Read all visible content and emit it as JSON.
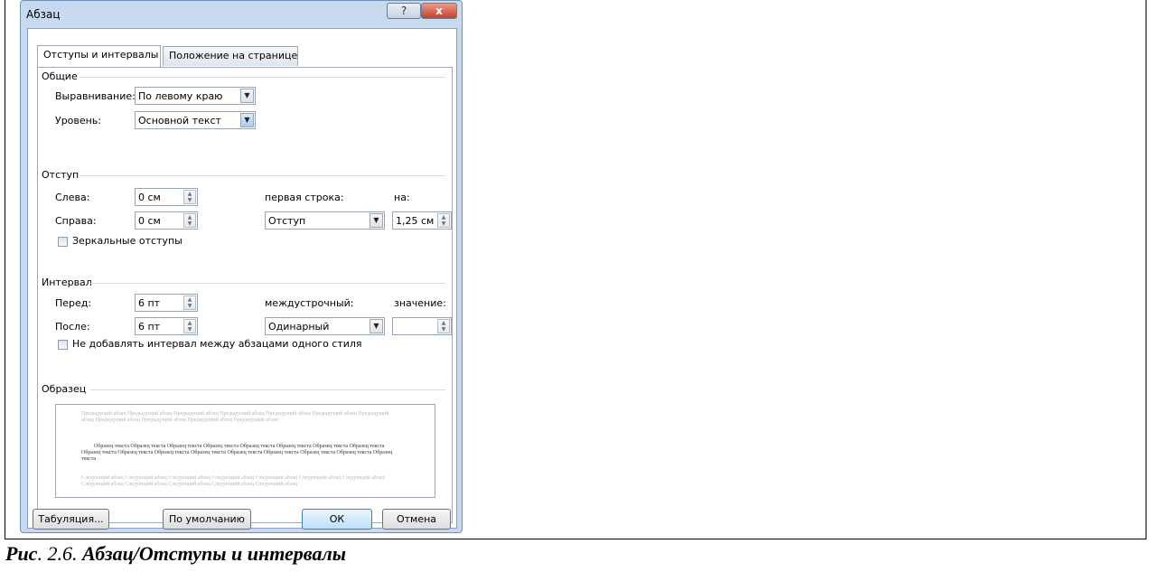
{
  "dialog": {
    "title": "Абзац",
    "help_label": "?",
    "close_label": "x"
  },
  "tabs": [
    {
      "label": "Отступы и интервалы",
      "active": true
    },
    {
      "label": "Положение на странице",
      "active": false
    }
  ],
  "general": {
    "section": "Общие",
    "alignment_label": "Выравнивание:",
    "alignment_value": "По левому краю",
    "level_label": "Уровень:",
    "level_value": "Основной текст"
  },
  "indent": {
    "section": "Отступ",
    "left_label": "Слева:",
    "left_value": "0 см",
    "right_label": "Справа:",
    "right_value": "0 см",
    "first_line_label": "первая строка:",
    "first_line_value": "Отступ",
    "by_label": "на:",
    "by_value": "1,25 см",
    "mirror_label": "Зеркальные отступы",
    "mirror_checked": false
  },
  "spacing": {
    "section": "Интервал",
    "before_label": "Перед:",
    "before_value": "6 пт",
    "after_label": "После:",
    "after_value": "6 пт",
    "line_label": "междустрочный:",
    "line_value": "Одинарный",
    "at_label": "значение:",
    "at_value": "",
    "no_space_label": "Не добавлять интервал между абзацами одного стиля",
    "no_space_checked": false
  },
  "preview": {
    "section": "Образец",
    "previous_text": "Предыдущий абзац Предыдущий абзац Предыдущий абзац Предыдущий абзац Предыдущий абзац Предыдущий абзац Предыдущий абзац Предыдущий абзац Предыдущий абзац Предыдущий абзац Предыдущий абзац",
    "sample_text": "Образец текста Образец текста Образец текста Образец текста Образец текста Образец текста Образец текста Образец текста Образец текста Образец текста Образец текста Образец текста Образец текста Образец текста Образец текста Образец текста Образец текста",
    "next_text": "Следующий абзац Следующий абзац Следующий абзац Следующий абзац Следующий абзац Следующий абзац Следующий абзац Следующий абзац Следующий абзац Следующий абзац Следующий абзац Следующий абзац"
  },
  "buttons": {
    "tabs": "Табуляция...",
    "default": "По умолчанию",
    "ok": "ОК",
    "cancel": "Отмена"
  },
  "caption": {
    "prefix": "Рис",
    "number": ". 2.6. ",
    "text": "Абзац/Отступы и интервалы"
  }
}
